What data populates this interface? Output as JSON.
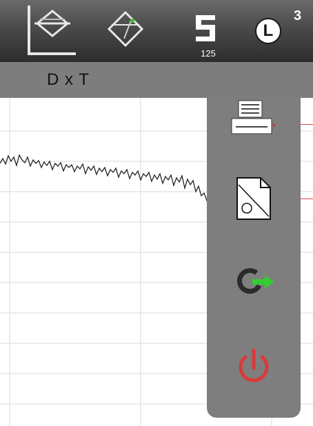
{
  "toolbar": {
    "tools": [
      {
        "icon": "axes-symmetry-icon"
      },
      {
        "icon": "diamond-measure-icon"
      },
      {
        "icon": "speed-icon",
        "label": "125"
      },
      {
        "icon": "layer-icon",
        "label": "L",
        "count": "3"
      }
    ]
  },
  "subbar": {
    "title": "D x T"
  },
  "side_panel": {
    "buttons": [
      {
        "icon": "printer-icon"
      },
      {
        "icon": "document-icon"
      },
      {
        "icon": "refresh-export-icon"
      },
      {
        "icon": "power-icon"
      }
    ]
  },
  "colors": {
    "panel": "#7e7e7e",
    "accent_red": "#d93a3a",
    "accent_green": "#33cc33",
    "grid": "#e6e6e6"
  }
}
